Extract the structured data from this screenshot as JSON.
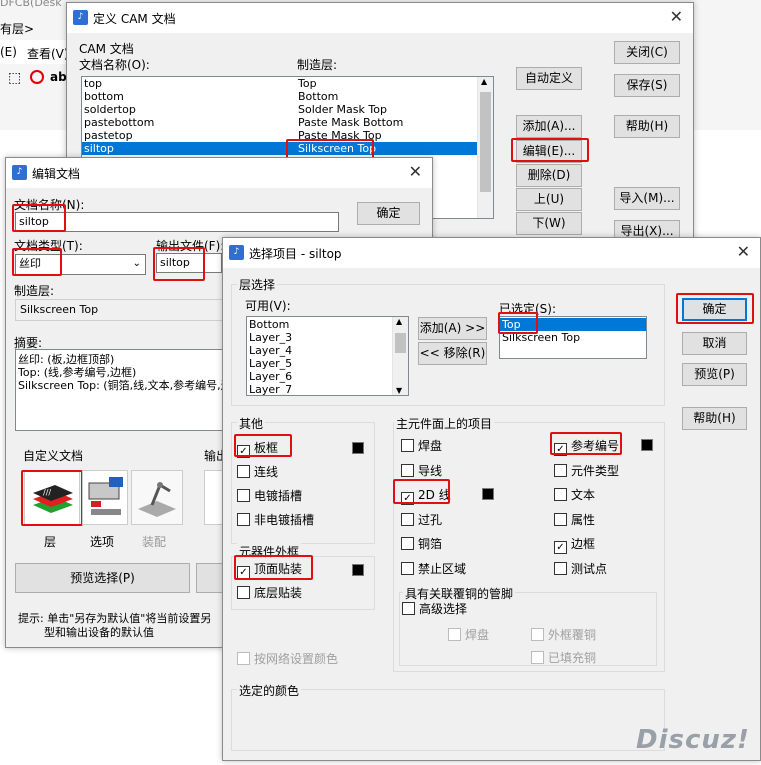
{
  "background": {
    "top_fragment": "DFCB(Desk",
    "layer_menu": "有层>",
    "menu_edit": "(E)",
    "menu_view": "查看(V)",
    "toolbar_text": "ab"
  },
  "cam_window": {
    "title": "定义 CAM 文档",
    "section_label": "CAM 文档",
    "col_doc_name": "文档名称(O):",
    "col_layer": "制造层:",
    "rows": [
      {
        "name": "top",
        "layer": "Top"
      },
      {
        "name": "bottom",
        "layer": "Bottom"
      },
      {
        "name": "soldertop",
        "layer": "Solder Mask Top"
      },
      {
        "name": "pastebottom",
        "layer": "Paste Mask Bottom"
      },
      {
        "name": "pastetop",
        "layer": "Paste Mask Top"
      },
      {
        "name": "siltop",
        "layer": "Silkscreen Top"
      }
    ],
    "buttons": {
      "auto_define": "自动定义",
      "add": "添加(A)...",
      "edit": "编辑(E)...",
      "delete": "删除(D)",
      "up": "上(U)",
      "down": "下(W)",
      "close": "关闭(C)",
      "save": "保存(S)",
      "help": "帮助(H)",
      "import": "导入(M)...",
      "export": "导出(X)..."
    }
  },
  "edit_window": {
    "title": "编辑文档",
    "doc_name_label": "文档名称(N):",
    "doc_name_value": "siltop",
    "ok": "确定",
    "doc_type_label": "文档类型(T):",
    "doc_type_value": "丝印",
    "output_file_label": "输出文件(F):",
    "output_file_value": "siltop",
    "layer_label": "制造层:",
    "layer_value": "Silkscreen Top",
    "summary_label": "摘要:",
    "summary_lines": [
      "丝印: (板,边框顶部)",
      "Top: (线,参考编号,边框)",
      "Silkscreen Top: (铜箔,线,文本,参考编号,边"
    ],
    "custom_doc_label": "自定义文档",
    "output_label_partial": "输出",
    "icons": {
      "layer": "层",
      "options": "选项",
      "assembly": "装配"
    },
    "preview_button": "预览选择(P)",
    "hint_line1": "提示: 单击\"另存为默认值\"将当前设置另",
    "hint_line2": "型和输出设备的默认值"
  },
  "select_window": {
    "title": "选择项目 - siltop",
    "layer_select_label": "层选择",
    "available_label": "可用(V):",
    "available_items": [
      "Bottom",
      "Layer_3",
      "Layer_4",
      "Layer_5",
      "Layer_6",
      "Layer_7"
    ],
    "selected_label": "已选定(S):",
    "selected_items": [
      "Top",
      "Silkscreen Top"
    ],
    "add_button": "添加(A) >>",
    "remove_button": "<< 移除(R)",
    "buttons": {
      "ok": "确定",
      "cancel": "取消",
      "preview": "预览(P)",
      "help": "帮助(H)"
    },
    "other_label": "其他",
    "other_items": [
      {
        "label": "板框",
        "checked": true
      },
      {
        "label": "连线",
        "checked": false
      },
      {
        "label": "电镀插槽",
        "checked": false
      },
      {
        "label": "非电镀插槽",
        "checked": false
      }
    ],
    "component_outline_label": "元器件外框",
    "component_items": [
      {
        "label": "顶面贴装",
        "checked": true
      },
      {
        "label": "底层贴装",
        "checked": false
      }
    ],
    "net_color": "按网络设置颜色",
    "main_items_label": "主元件面上的项目",
    "main_col1": [
      {
        "label": "焊盘",
        "checked": false
      },
      {
        "label": "导线",
        "checked": false
      },
      {
        "label": "2D 线",
        "checked": true
      },
      {
        "label": "过孔",
        "checked": false
      },
      {
        "label": "铜箔",
        "checked": false
      },
      {
        "label": "禁止区域",
        "checked": false
      }
    ],
    "main_col2": [
      {
        "label": "参考编号",
        "checked": true
      },
      {
        "label": "元件类型",
        "checked": false
      },
      {
        "label": "文本",
        "checked": false
      },
      {
        "label": "属性",
        "checked": false
      },
      {
        "label": "边框",
        "checked": true
      },
      {
        "label": "测试点",
        "checked": false
      }
    ],
    "copper_pour_label": "具有关联覆铜的管脚",
    "advanced": "高级选择",
    "pad": "焊盘",
    "outline_pour": "外框覆铜",
    "filled_copper": "已填充铜",
    "selected_color_label": "选定的颜色"
  },
  "watermark": "Discuz!"
}
